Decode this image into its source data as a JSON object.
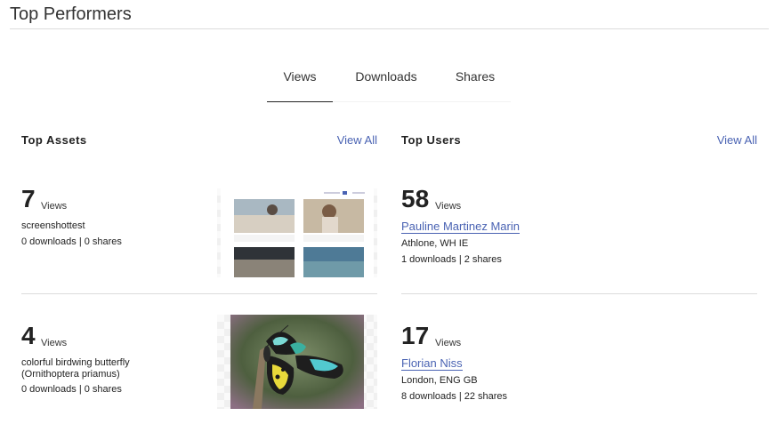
{
  "page": {
    "title": "Top Performers"
  },
  "tabs": [
    {
      "label": "Views",
      "active": true
    },
    {
      "label": "Downloads",
      "active": false
    },
    {
      "label": "Shares",
      "active": false
    }
  ],
  "top_assets": {
    "title": "Top Assets",
    "view_all": "View All",
    "items": [
      {
        "count": "7",
        "unit": "Views",
        "name": "screenshottest",
        "stats": "0 downloads | 0 shares",
        "thumb_icon": "screenshot-thumbnail"
      },
      {
        "count": "4",
        "unit": "Views",
        "name": "colorful birdwing butterfly (Ornithoptera priamus)",
        "stats": "0 downloads | 0 shares",
        "thumb_icon": "butterfly-thumbnail"
      }
    ]
  },
  "top_users": {
    "title": "Top Users",
    "view_all": "View All",
    "items": [
      {
        "count": "58",
        "unit": "Views",
        "name": "Pauline Martinez Marin",
        "location": "Athlone, WH IE",
        "stats": "1 downloads | 2 shares"
      },
      {
        "count": "17",
        "unit": "Views",
        "name": "Florian Niss",
        "location": "London, ENG GB",
        "stats": "8 downloads | 22 shares"
      }
    ]
  },
  "colors": {
    "link": "#4a63b3",
    "text": "#222222",
    "divider": "#dcdcdc"
  }
}
